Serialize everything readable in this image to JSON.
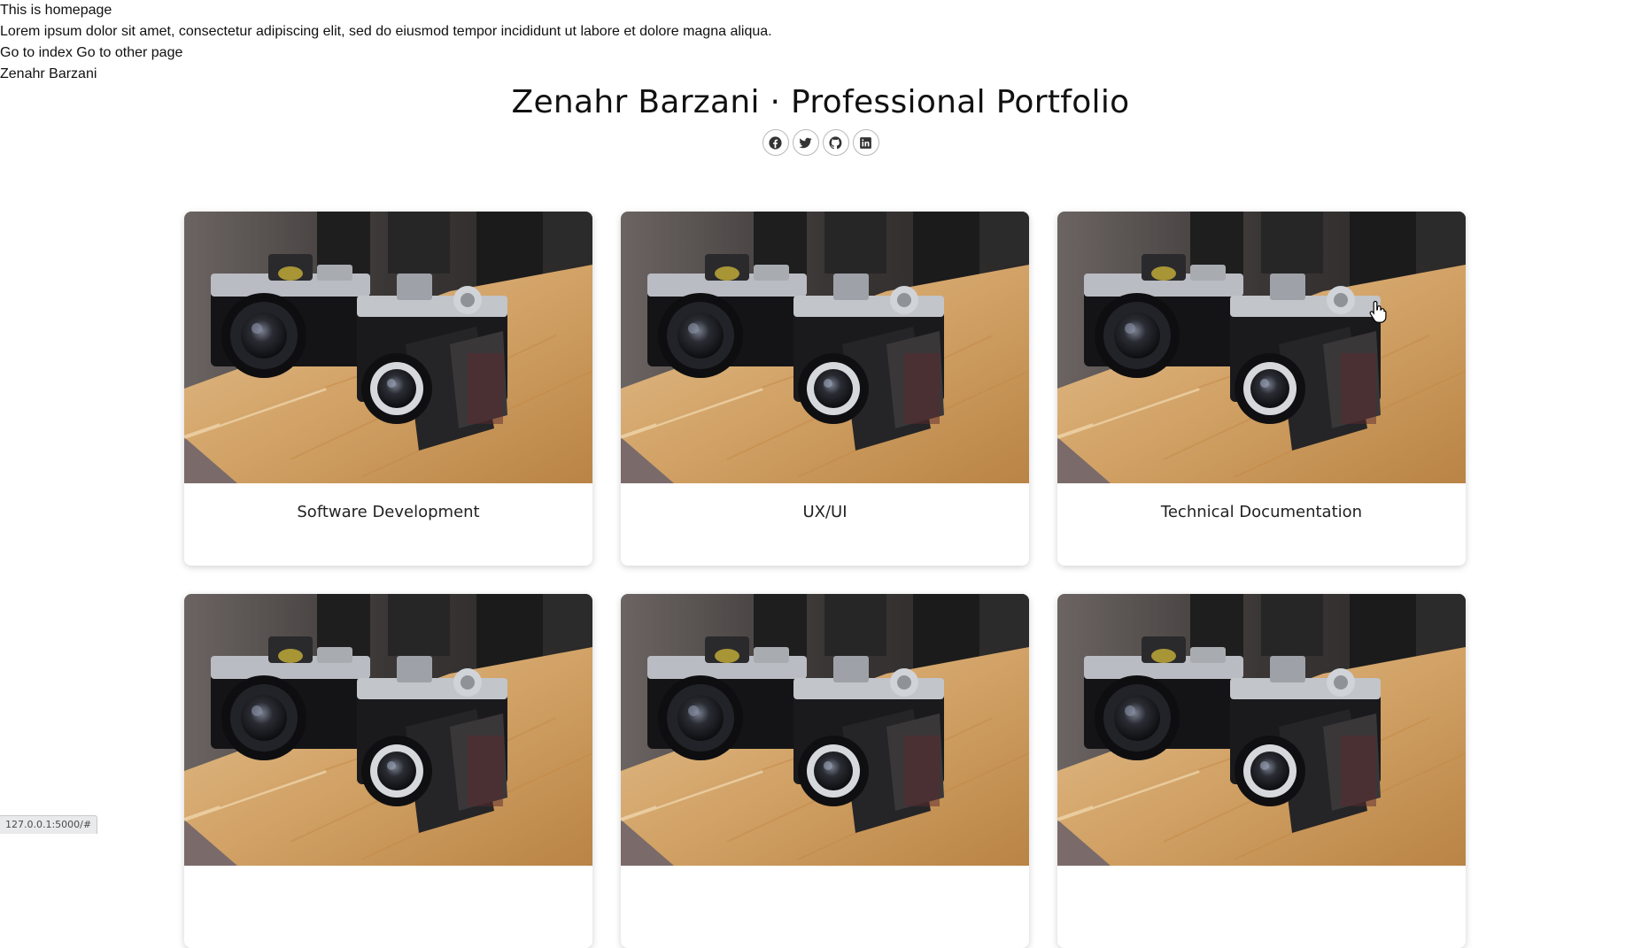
{
  "intro": {
    "homepage_text": "This is homepage",
    "lorem": "Lorem ipsum dolor sit amet, consectetur adipiscing elit, sed do eiusmod tempor incididunt ut labore et dolore magna aliqua.",
    "link_index": "Go to index",
    "link_other": "Go to other page",
    "name": "Zenahr Barzani"
  },
  "header": {
    "title": "Zenahr Barzani · Professional Portfolio",
    "socials": [
      {
        "icon": "facebook-icon"
      },
      {
        "icon": "twitter-icon"
      },
      {
        "icon": "github-icon"
      },
      {
        "icon": "linkedin-icon"
      }
    ]
  },
  "cards": [
    {
      "caption": "Software Development",
      "image": "camera-photo"
    },
    {
      "caption": "UX/UI",
      "image": "camera-photo"
    },
    {
      "caption": "Technical Documentation",
      "image": "camera-photo"
    },
    {
      "caption": "",
      "image": "camera-photo"
    },
    {
      "caption": "",
      "image": "camera-photo"
    },
    {
      "caption": "",
      "image": "camera-photo"
    }
  ],
  "statusbar": {
    "url": "127.0.0.1:5000/#"
  },
  "colors": {
    "social_icon": "#333333",
    "card_shadow": "rgba(0,0,0,0.18)"
  }
}
